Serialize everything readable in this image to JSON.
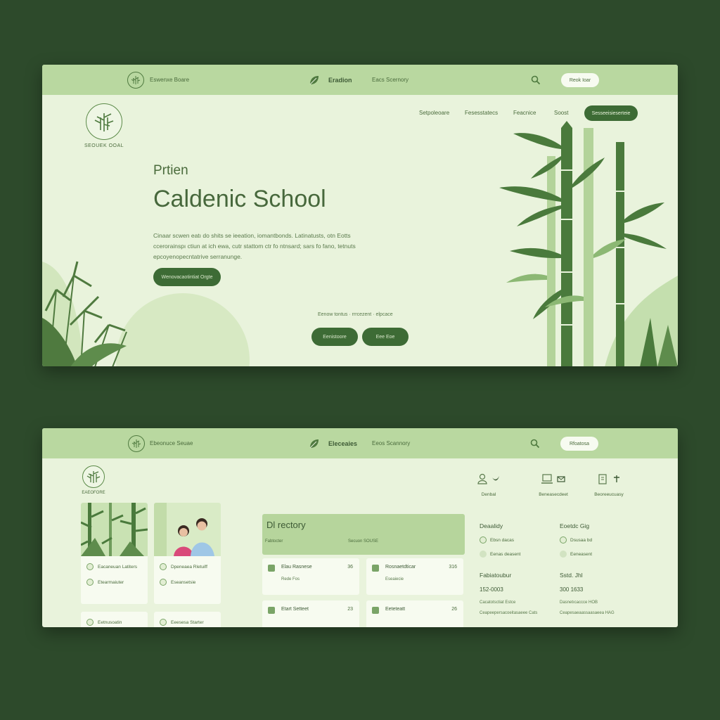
{
  "colors": {
    "background": "#2d4a2b",
    "panel": "#e9f3dc",
    "topbar": "#b9d8a0",
    "accent_dark": "#3d6b35",
    "text": "#3d5a35",
    "card": "#f7fbf0"
  },
  "hero": {
    "topbar": {
      "logo_icon": "bamboo-icon",
      "left_text": "Eswenxe Boare",
      "brand_icon": "leaf-icon",
      "brand_name": "Eradion",
      "mid_text": "Eacs Scernory",
      "search_icon": "search-icon",
      "pill_label": "Reok Ioar"
    },
    "logo": {
      "icon": "bamboo-icon",
      "text": "SEOUEK OOAL"
    },
    "nav": {
      "links": [
        "Setpoleoare",
        "Fesesstatecs",
        "Feacnice",
        "Soost"
      ],
      "cta_label": "Sesseeisieserteie"
    },
    "eyebrow": "Prtien",
    "title": "Caldenic School",
    "body": [
      "Cinaar scwen eatı do shits se ieeation, iomantbonds. Latinatusts, otn Eotts",
      "ccerorainspı ctiun at ich ewa, cutr stattom ctr fo ntnsard; sars fo fano, tetnuts",
      "epcoyenopecntatrive serranunge."
    ],
    "primary_button": "Wenovacaotintiat Orgte",
    "center_links": "Eenow  tontus  ·  rrrcezent  ·  elpcace",
    "buttons": [
      "Eenistoore",
      "Eee Eoe"
    ]
  },
  "directory": {
    "topbar": {
      "logo_icon": "bamboo-icon",
      "left_text": "Ebeonuce Seuae",
      "brand_icon": "leaf-icon",
      "brand_name": "Eleceaies",
      "mid_text": "Eeos Scannory",
      "search_icon": "search-icon",
      "pill_label": "Rfoatosa"
    },
    "logo": {
      "icon": "bamboo-icon",
      "text": "EAEOFORE"
    },
    "photo_cards": [
      {
        "image": "bamboo-photo",
        "rows": [
          "Eacaneuan Latiters",
          "Etearmaiuter"
        ]
      },
      {
        "image": "students-photo",
        "rows": [
          "Dpeneaea Rletuiff",
          "Eseansetsie"
        ]
      }
    ],
    "mini_cards": [
      "Eetnusoatin",
      "Eeesesa Starter"
    ],
    "directory_box": {
      "title": "Dl rectory",
      "sub_left": "Fabtocter",
      "sub_right": "Secuon SOUSE"
    },
    "list": [
      {
        "title": "Elau Rasnese",
        "num": "36",
        "sub": "Rede Fos"
      },
      {
        "title": "Rosnaetdticar",
        "num": "316",
        "sub": "Eseaiecie"
      },
      {
        "title": "Etart Setteet",
        "num": "23",
        "sub": ""
      },
      {
        "title": "Eeteteatt",
        "num": "26",
        "sub": ""
      }
    ],
    "icon_items": [
      {
        "label": "Denbal"
      },
      {
        "label": "Beneasecdeet"
      },
      {
        "label": "Beoreeucuasy"
      }
    ],
    "info": {
      "col1": {
        "head": "Deaalidy",
        "rows": [
          "Ebsn dacas",
          "Eenas deasent"
        ],
        "sub_head": "Fabiatoubur",
        "number": "152-0003",
        "lines": [
          "Cacatotsctiat Estce",
          "Ceapeepersacoeitasaeee Cats"
        ]
      },
      "col2": {
        "head": "Eoetdc Gig",
        "rows": [
          "Dsusaa bd",
          "Eeneasent"
        ],
        "sub_head": "Sstd. Jhl",
        "number": "300 1633",
        "lines": [
          "Dasnetıcaccce HOB",
          "Ceapesaeaassaasaeea HAG"
        ]
      }
    }
  }
}
